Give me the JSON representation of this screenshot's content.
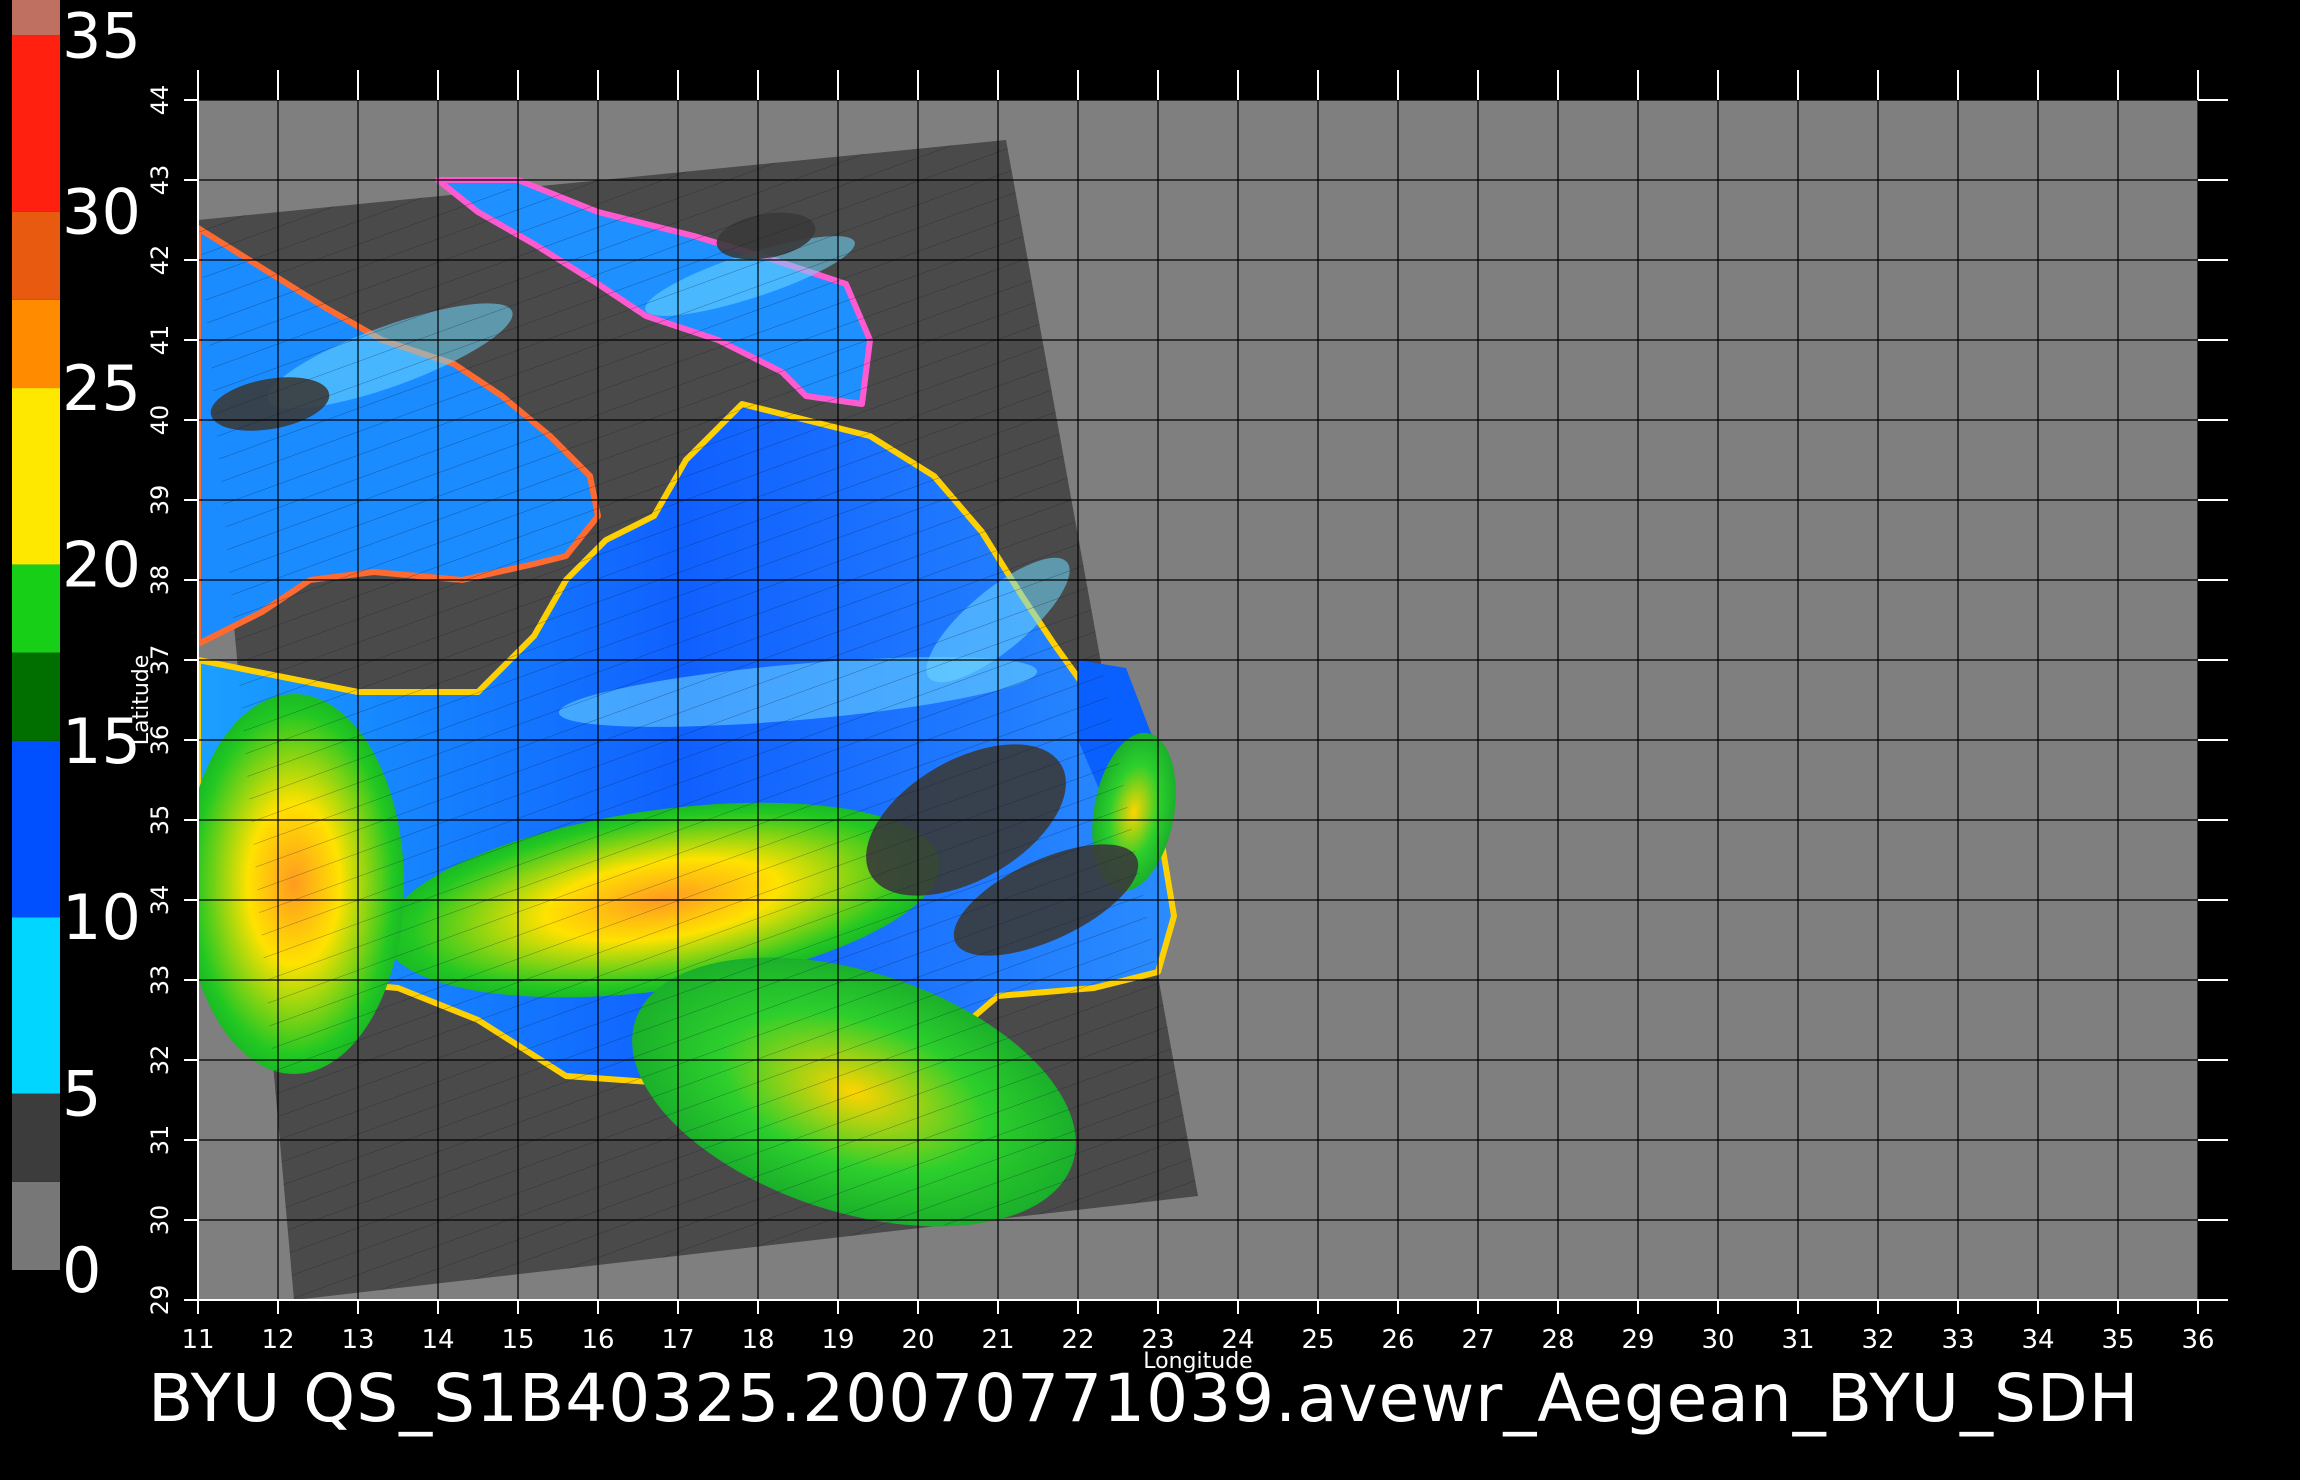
{
  "title": "BYU  QS_S1B40325.20070771039.avewr_Aegean_BYU_SDH",
  "x_axis_label": "Longitude",
  "y_axis_label": "Latitude",
  "colorbar": {
    "ticks": [
      0,
      5,
      10,
      15,
      20,
      25,
      30,
      35
    ],
    "tick_labels": [
      "0",
      "5",
      "10",
      "15",
      "20",
      "25",
      "30",
      "35"
    ],
    "bands": [
      {
        "from": 0,
        "to": 2.5,
        "color": "#777777"
      },
      {
        "from": 2.5,
        "to": 5,
        "color": "#3c3c3c"
      },
      {
        "from": 5,
        "to": 10,
        "color": "#00d6ff"
      },
      {
        "from": 10,
        "to": 15,
        "color": "#0050ff"
      },
      {
        "from": 15,
        "to": 17.5,
        "color": "#006f00"
      },
      {
        "from": 17.5,
        "to": 20,
        "color": "#16cf16"
      },
      {
        "from": 20,
        "to": 25,
        "color": "#ffe800"
      },
      {
        "from": 25,
        "to": 27.5,
        "color": "#ff8c00"
      },
      {
        "from": 27.5,
        "to": 30,
        "color": "#e85a10"
      },
      {
        "from": 30,
        "to": 35,
        "color": "#ff2010"
      },
      {
        "from": 35,
        "to": 36,
        "color": "#c07060"
      }
    ]
  },
  "chart_data": {
    "type": "heatmap",
    "title": "BYU  QS_S1B40325.20070771039.avewr_Aegean_BYU_SDH",
    "xlabel": "Longitude",
    "ylabel": "Latitude",
    "xlim": [
      11,
      36
    ],
    "ylim": [
      29,
      44
    ],
    "x_ticks": [
      11,
      12,
      13,
      14,
      15,
      16,
      17,
      18,
      19,
      20,
      21,
      22,
      23,
      24,
      25,
      26,
      27,
      28,
      29,
      30,
      31,
      32,
      33,
      34,
      35,
      36
    ],
    "y_ticks": [
      29,
      30,
      31,
      32,
      33,
      34,
      35,
      36,
      37,
      38,
      39,
      40,
      41,
      42,
      43,
      44
    ],
    "grid": true,
    "colorbar_range": [
      0,
      35
    ],
    "swath_corners": [
      [
        11.0,
        42.5
      ],
      [
        21.1,
        43.5
      ],
      [
        23.5,
        30.3
      ],
      [
        12.2,
        29.0
      ]
    ],
    "colors": {
      "background": "#7f7f7f",
      "swath": "#4a4a4a",
      "land": "#4a4a4a"
    }
  }
}
